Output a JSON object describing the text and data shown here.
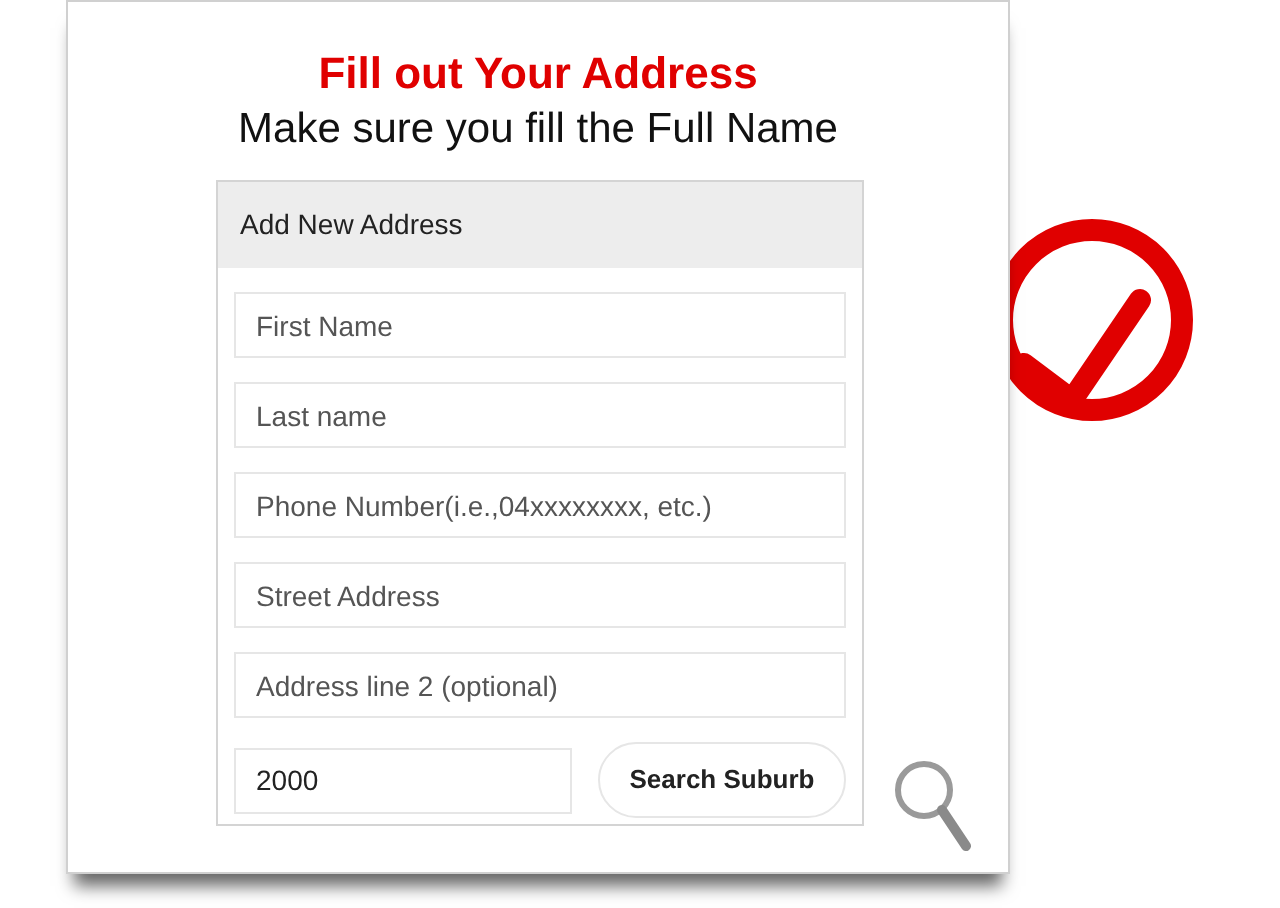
{
  "title": "Fill out Your Address",
  "subtitle": "Make sure you fill the Full Name",
  "panel": {
    "header": "Add New Address",
    "fields": [
      {
        "placeholder": "First Name"
      },
      {
        "placeholder": "Last name"
      },
      {
        "placeholder": "Phone Number(i.e.,04xxxxxxxx, etc.)"
      },
      {
        "placeholder": "Street Address"
      },
      {
        "placeholder": "Address line 2 (optional)"
      }
    ],
    "postcode": {
      "value": "2000"
    },
    "button": "Search Suburb"
  }
}
